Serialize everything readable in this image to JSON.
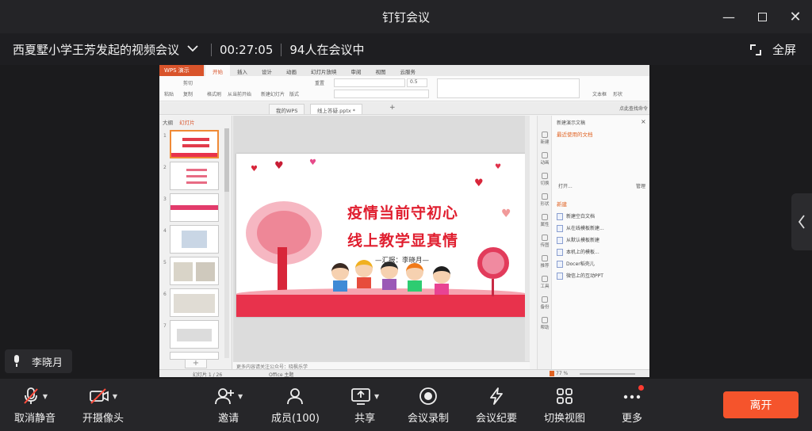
{
  "window": {
    "title": "钉钉会议"
  },
  "header": {
    "meeting_name": "西夏墅小学王芳发起的视频会议",
    "duration": "00:27:05",
    "participants_status": "94人在会议中",
    "fullscreen_label": "全屏"
  },
  "wps": {
    "app_tab": "WPS 演示",
    "menu": [
      "开始",
      "插入",
      "设计",
      "动画",
      "幻灯片放映",
      "审阅",
      "视图",
      "云服务"
    ],
    "ribbon": {
      "paste": "粘贴",
      "cut": "剪切",
      "copy": "复制",
      "format_painter": "格式刷",
      "from_current": "从当前开始",
      "new_slide": "新建幻灯片",
      "layout": "版式",
      "reset": "重置",
      "font_size": "0.5",
      "textbox": "文本框",
      "shape": "形状",
      "search": "点此查找命令"
    },
    "doc_tabs": [
      "我的WPS",
      "线上答疑.pptx *"
    ],
    "thumb_header": [
      "大纲",
      "幻灯片"
    ],
    "slide": {
      "line1": "疫情当前守初心",
      "line2": "线上教学显真情",
      "line3": "—汇报：李晓月—"
    },
    "notes_placeholder": "更多内容请关注公众号：晓枫乐学",
    "status": {
      "slide_index": "幻灯片 1 / 26",
      "theme": "Office 主题",
      "zoom": "77 %"
    },
    "right_pane": {
      "title": "新建演示文稿",
      "recent": "最近使用的文档",
      "open": "打开...",
      "manage": "管理",
      "new_section": "新建",
      "items": [
        "新建空白文档",
        "从在线模板新建...",
        "从默认模板新建",
        "本机上的模板...",
        "Docer稻壳儿",
        "微信上的互动PPT"
      ],
      "side_icons": [
        "新建",
        "动画",
        "切换",
        "形状",
        "属性",
        "传图",
        "推荐",
        "工具",
        "备份",
        "帮助"
      ]
    }
  },
  "speaker": {
    "name": "李晓月"
  },
  "toolbar": {
    "unmute": "取消静音",
    "camera": "开摄像头",
    "invite": "邀请",
    "members": "成员(100)",
    "share": "共享",
    "record": "会议录制",
    "minutes": "会议纪要",
    "switch_view": "切换视图",
    "more": "更多",
    "leave": "离开"
  }
}
